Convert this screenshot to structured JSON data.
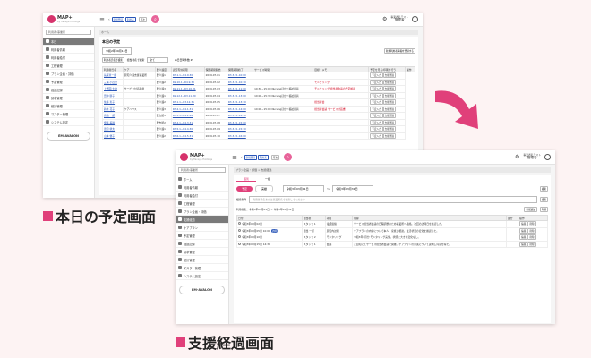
{
  "shot1": {
    "logo": "MAP+",
    "logo_sub": "by Hanaya Holdings",
    "header_buttons": [
      "新規登録",
      "利用者",
      "月次"
    ],
    "header_right": [
      "事業者名テスト",
      "管理者"
    ],
    "search_placeholder": "利用者/事業所",
    "sidebar_items": [
      "本日",
      "利用者情報",
      "利用者給付",
      "工程管理",
      "プラン企画・評価",
      "予定管理",
      "経過記録",
      "請求管理",
      "統計管理",
      "マスター管理",
      "システム設定"
    ],
    "sidebar_logo": "EM-AVALON",
    "breadcrumb": "ホーム",
    "title": "本日の予定",
    "date": "令和2年09月13日",
    "filter_label1": "利用者氏名で検索",
    "filter_label2": "担当者名で検索",
    "filter_select": "全て",
    "count_label": "本日日時件数 25",
    "new_button": "新規利用者情報を登録する",
    "columns": [
      "利用者氏名",
      "ケア",
      "要介護度",
      "認定有効期限",
      "保険期間開始",
      "保険期間終了",
      "サービス時間",
      "目標・メモ",
      "予定を見る/印刷を行う",
      "操作"
    ],
    "rows": [
      {
        "name": "長尾恵一郎",
        "care": "居宅介護支援事業所",
        "lvl": "要介護1",
        "d1": "R3.1.1~R4.9.30",
        "d2": "2019-07-01",
        "d3": "R3.3.31-10:00",
        "memo": "",
        "red": ""
      },
      {
        "name": "三浦 小百合",
        "care": "",
        "lvl": "要介護2",
        "d1": "R2.10.1~R4.9.30",
        "d2": "2019-07-02",
        "d3": "R3.3.31-10:30",
        "memo": "",
        "red": "モニタリング"
      },
      {
        "name": "上野岡 大地",
        "care": "サービス付高齢者",
        "lvl": "要介護3",
        "d1": "R2.11.1~R3.10.31",
        "d2": "2019-07-03",
        "d3": "R3.3.31-11:00",
        "memo": "10:30~15:00 Nursingほか2 福祉用具",
        "red": "モニタリング 担当者会議の予定確認"
      },
      {
        "name": "田中 勝子",
        "care": "",
        "lvl": "要介護1",
        "d1": "R2.12.1~R3.11.30",
        "d2": "2019-07-04",
        "d3": "R3.3.31-13:00",
        "memo": "10:00~15:30 Nursingほか2 福祉用具",
        "red": ""
      },
      {
        "name": "佐藤 恵子",
        "care": "",
        "lvl": "要介護2",
        "d1": "R3.1.1~R3.12.31",
        "d2": "2019-07-05",
        "d3": "R3.3.31-13:30",
        "memo": "",
        "red": "担当者会"
      },
      {
        "name": "鈴木 花子",
        "care": "ケアハウス",
        "lvl": "要介護3",
        "d1": "R3.2.1~R4.1.31",
        "d2": "2019-07-06",
        "d3": "R3.3.31-14:00",
        "memo": "10:00~15:00 Nursingほか2 福祉用具",
        "red": "担当者会議 サービス計画書"
      },
      {
        "name": "高橋 一郎",
        "care": "",
        "lvl": "要支援1",
        "d1": "R3.3.1~R4.2.28",
        "d2": "2019-07-07",
        "d3": "R3.3.31-14:30",
        "memo": "",
        "red": ""
      },
      {
        "name": "伊藤 美咲",
        "care": "",
        "lvl": "要支援2",
        "d1": "R3.4.1~R4.3.31",
        "d2": "2019-07-08",
        "d3": "R3.3.31-15:00",
        "memo": "",
        "red": ""
      },
      {
        "name": "渡辺 健太",
        "care": "",
        "lvl": "要介護1",
        "d1": "R3.5.1~R4.4.30",
        "d2": "2019-07-09",
        "d3": "R3.3.31-15:30",
        "memo": "",
        "red": ""
      },
      {
        "name": "山本 優子",
        "care": "",
        "lvl": "要介護2",
        "d1": "R3.6.1~R4.5.31",
        "d2": "2019-07-10",
        "d3": "R3.3.31-16:00",
        "memo": "",
        "red": ""
      }
    ],
    "row_buttons": [
      "予定入力",
      "支援経過"
    ]
  },
  "shot2": {
    "logo": "MAP+",
    "logo_sub": "by Hanaya Holdings",
    "header_buttons": [
      "新規登録",
      "利用者",
      "月次"
    ],
    "header_right": [
      "事業者名テスト",
      "管理者"
    ],
    "search_placeholder": "利用者/事業所",
    "sidebar_items": [
      "ホーム",
      "利用者情報",
      "利用者給付",
      "工程管理",
      "プラン企画・評価",
      "支援経過",
      "ケアプラン",
      "予定管理",
      "経過記録",
      "請求管理",
      "統計管理",
      "マスター管理",
      "システム設定"
    ],
    "sidebar_logo": "EM-AVALON",
    "breadcrumb": "プラン企画・評価 > 支援経過",
    "tabs": [
      "個別",
      "一括"
    ],
    "filter_pills": [
      "予定",
      "実績"
    ],
    "date_from": "令和3年03月01日",
    "date_to": "令和3年03月31日",
    "search_button": "検索",
    "keyword_label": "検索条件",
    "keyword_placeholder": "利用者氏名または事業所名で検索してください",
    "result_label": "利用者名：令和3年03月01日 〜 令和3年03月31日",
    "add_button": "新規追加",
    "print_button": "印刷",
    "columns": [
      "日付",
      "担当者",
      "項目",
      "内容",
      "区分",
      "操作"
    ],
    "rows": [
      {
        "date": "令和3年03月02日",
        "staff": "スタッフ 1",
        "item": "電話連絡",
        "body": "サービス担当者会議の日程調整のため事業所へ連絡。次回の訪問日を確認した。"
      },
      {
        "date": "令和3年03月05日 10:00",
        "staff": "担当 一郎",
        "item": "居宅内訪問",
        "body": "ケアプランの内容について本人・家族と相談。生活状況の変化を確認した。",
        "tag": "訪問"
      },
      {
        "date": "令和3年03月10日",
        "staff": "スタッフ 2",
        "item": "モニタリング",
        "body": "令和3年3月分 モニタリング実施。状態に大きな変化なし。"
      },
      {
        "date": "令和3年03月15日 14:30",
        "staff": "スタッフ 1",
        "item": "会議",
        "body": "ご自宅にてサービス担当者会議を開催。ケアプランの原案について説明し同意を得た。"
      }
    ],
    "row_buttons": [
      "編集",
      "削除"
    ]
  },
  "captions": {
    "top": "本日の予定画面",
    "bottom": "支援経過画面"
  },
  "colors": {
    "accent": "#e0407a",
    "arrow": "#e0407a",
    "background": "#fdf3f3"
  }
}
